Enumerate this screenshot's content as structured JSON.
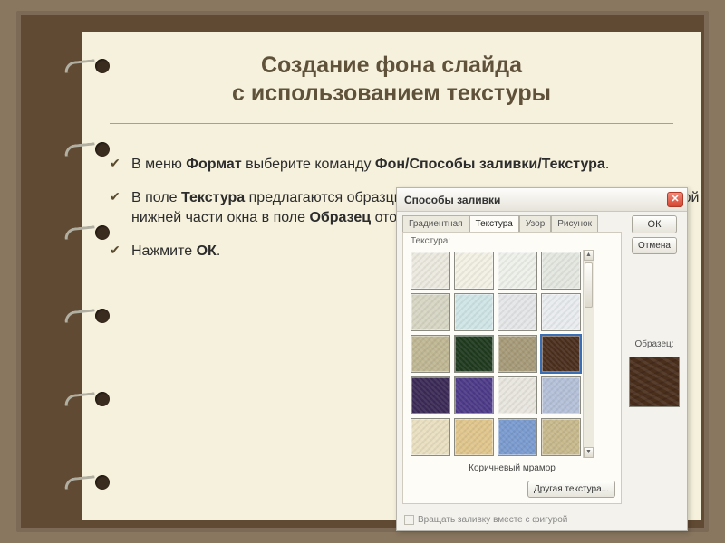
{
  "slide": {
    "title_line1": "Создание фона слайда",
    "title_line2": "с использованием текстуры",
    "bullets": [
      {
        "pre": "В меню ",
        "b1": "Формат",
        "mid1": " выберите команду ",
        "b2": "Фон/Способы заливки/Текстура",
        "post": "."
      },
      {
        "pre": "В поле ",
        "b1": "Текстура",
        "mid1": " предлагаются образцы текстур. Выберите необходимый. В правой нижней части окна в поле ",
        "b2": "Образец",
        "post": " отображается выбранный вариант текстуры."
      },
      {
        "pre": "Нажмите ",
        "b1": "ОК",
        "mid1": "",
        "b2": "",
        "post": "."
      }
    ]
  },
  "dialog": {
    "title": "Способы заливки",
    "tabs": [
      "Градиентная",
      "Текстура",
      "Узор",
      "Рисунок"
    ],
    "active_tab": 1,
    "group_label": "Текстура:",
    "selected_texture_name": "Коричневый мрамор",
    "other_texture_btn": "Другая текстура...",
    "ok_btn": "ОК",
    "cancel_btn": "Отмена",
    "sample_label": "Образец:",
    "footer_checkbox": "Вращать заливку вместе с фигурой",
    "textures": [
      {
        "bg": "#eceadf"
      },
      {
        "bg": "#f3f0e4"
      },
      {
        "bg": "#eef0ea"
      },
      {
        "bg": "#e3e7e0"
      },
      {
        "bg": "#d7d6c4"
      },
      {
        "bg": "#cfe5e6"
      },
      {
        "bg": "#e4e6e8"
      },
      {
        "bg": "#e9ecef"
      },
      {
        "bg": "#bfb793"
      },
      {
        "bg": "#1f3a1e"
      },
      {
        "bg": "#a69a78"
      },
      {
        "bg": "#4b2f1d"
      },
      {
        "bg": "#3b2a56"
      },
      {
        "bg": "#4d3a88"
      },
      {
        "bg": "#e8e6de"
      },
      {
        "bg": "#b4c0d8"
      },
      {
        "bg": "#e9dfc0"
      },
      {
        "bg": "#e0c68c"
      },
      {
        "bg": "#7a9bcf"
      },
      {
        "bg": "#c8b98c"
      }
    ],
    "selected_index": 11,
    "sample_swatch": "#4b2f1d"
  }
}
